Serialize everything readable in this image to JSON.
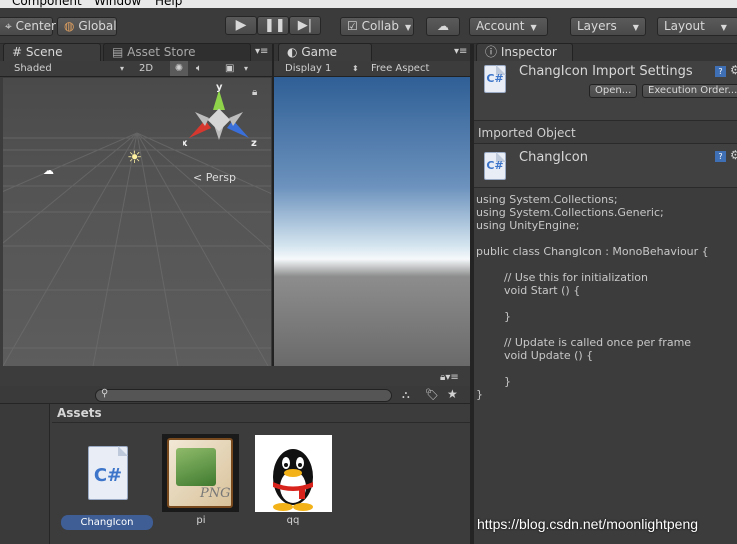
{
  "menubar": {
    "items": [
      "Component",
      "Window",
      "Help"
    ]
  },
  "toolbar": {
    "center": "Center",
    "global": "Global",
    "collab": "Collab",
    "account": "Account",
    "layers": "Layers",
    "layout": "Layout"
  },
  "scene": {
    "tab": "Scene",
    "asset_store_tab": "Asset Store",
    "shading": "Shaded",
    "mode_2d": "2D",
    "gizmo": {
      "y": "y",
      "x": "x",
      "z": "z",
      "persp": "Persp"
    }
  },
  "game": {
    "tab": "Game",
    "display": "Display 1",
    "aspect": "Free Aspect"
  },
  "inspector": {
    "tab": "Inspector",
    "title": "ChangIcon Import Settings",
    "open_btn": "Open...",
    "exec_order_btn": "Execution Order...",
    "imported_object": "Imported Object",
    "object_name": "ChangIcon",
    "code": [
      "using System.Collections;",
      "using System.Collections.Generic;",
      "using UnityEngine;",
      "",
      "public class ChangIcon : MonoBehaviour {",
      "",
      "        // Use this for initialization",
      "        void Start () {",
      "",
      "        }",
      "",
      "        // Update is called once per frame",
      "        void Update () {",
      "",
      "        }",
      "}"
    ]
  },
  "project": {
    "assets_label": "Assets",
    "items": [
      {
        "name": "ChangIcon",
        "selected": true
      },
      {
        "name": "pi",
        "selected": false
      },
      {
        "name": "qq",
        "selected": false
      }
    ]
  },
  "watermark": "https://blog.csdn.net/moonlightpeng"
}
